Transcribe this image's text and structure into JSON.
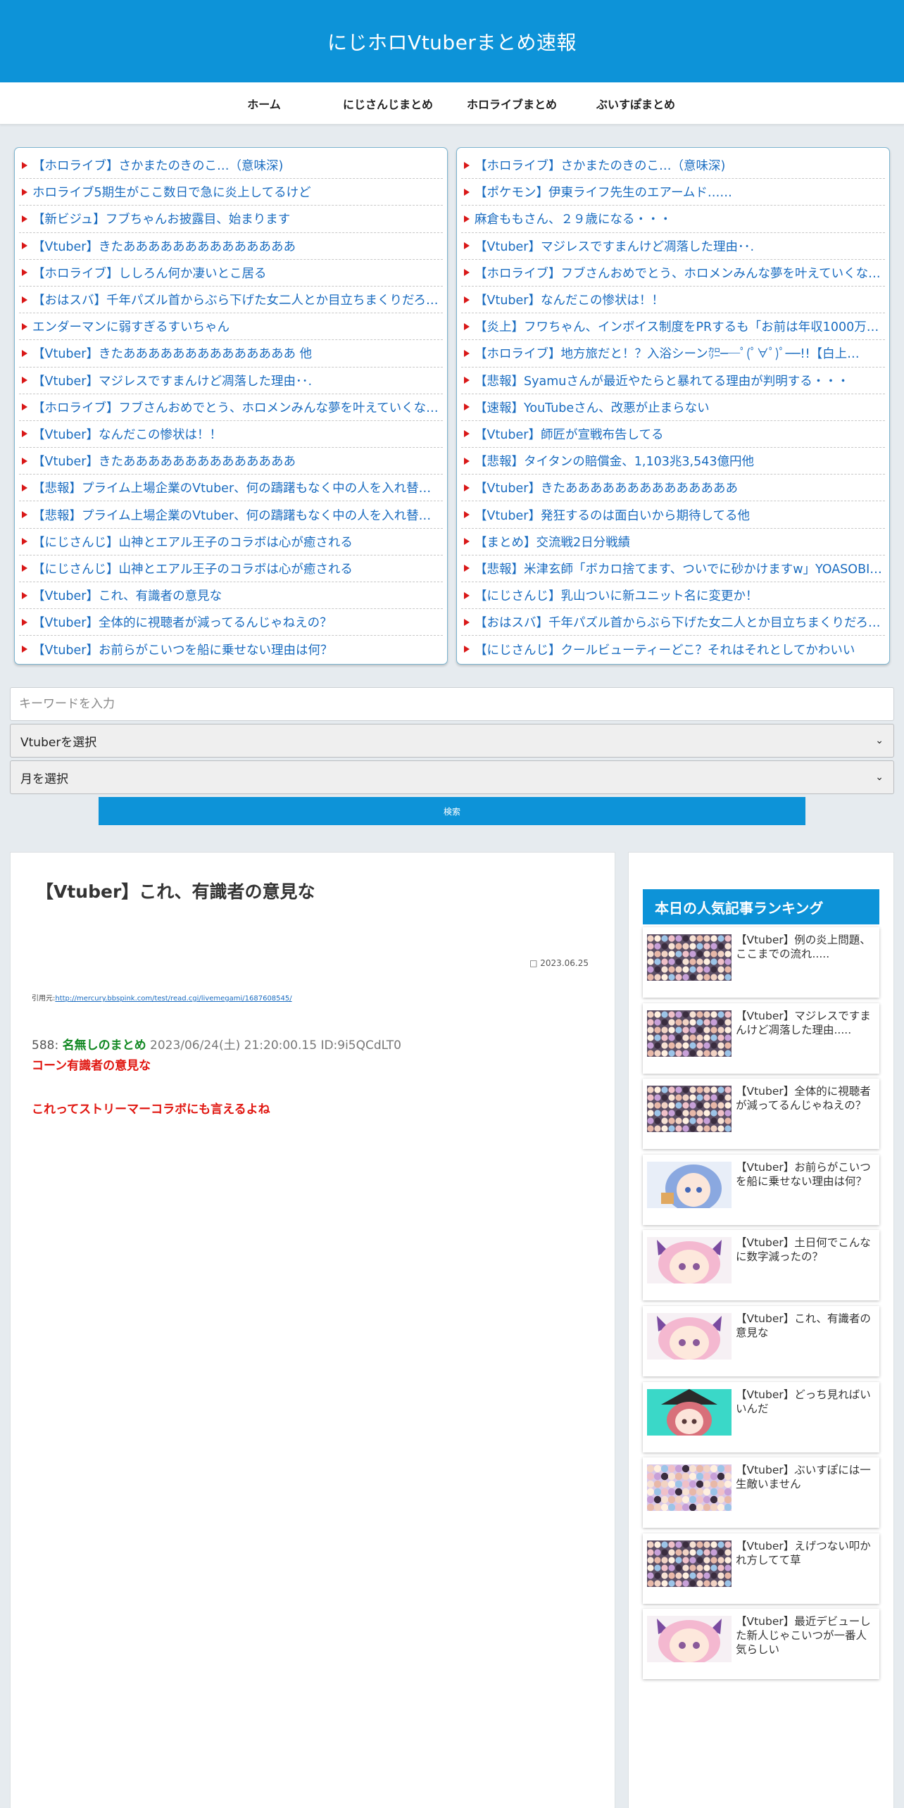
{
  "site": {
    "title": "にじホロVtuberまとめ速報"
  },
  "nav": [
    {
      "label": "ホーム"
    },
    {
      "label": "にじさんじまとめ"
    },
    {
      "label": "ホロライブまとめ"
    },
    {
      "label": "ぶいすぽまとめ"
    }
  ],
  "left_links": [
    "【ホロライブ】さかまたのきのこ…（意味深)",
    "ホロライブ5期生がここ数日で急に炎上してるけど",
    "【新ビジュ】フブちゃんお披露目、始まります",
    "【Vtuber】きたああああああああああああああ",
    "【ホロライブ】ししろん何か凄いとこ居る",
    "【おはスバ】千年パズル首からぶら下げた女二人とか目立ちまくりだろ…",
    "エンダーマンに弱すぎるすいちゃん",
    "【Vtuber】きたああああああああああああああ 他",
    "【Vtuber】マジレスですまんけど凋落した理由･･.",
    "【ホロライブ】フブさんおめでとう、ホロメンみんな夢を叶えていくな…",
    "【Vtuber】なんだこの惨状は！！",
    "【Vtuber】きたああああああああああああああ",
    "【悲報】プライム上場企業のVtuber、何の躊躇もなく中の人を入れ替え…",
    "【悲報】プライム上場企業のVtuber、何の躊躇もなく中の人を入れ替え…",
    "【にじさんじ】山神とエアル王子のコラボは心が癒される",
    "【にじさんじ】山神とエアル王子のコラボは心が癒される",
    "【Vtuber】これ、有識者の意見な",
    "【Vtuber】全体的に視聴者が減ってるんじゃねえの？",
    "【Vtuber】お前らがこいつを船に乗せない理由は何？"
  ],
  "right_links": [
    "【ホロライブ】さかまたのきのこ…（意味深)",
    "【ポケモン】伊東ライフ先生のエアームド……",
    "麻倉ももさん、２９歳になる・・・",
    "【Vtuber】マジレスですまんけど凋落した理由･･.",
    "【ホロライブ】フブさんおめでとう、ホロメンみんな夢を叶えていくな…",
    "【Vtuber】なんだこの惨状は！！",
    "【炎上】フワちゃん、インボイス制度をPRするも「お前は年収1000万…",
    "【ホロライブ】地方旅だと！？入浴シーン㌍──ﾟ(ﾟ∀ﾟ)ﾟ──!!【白上…",
    "【悲報】Syamuさんが最近やたらと暴れてる理由が判明する・・・",
    "【速報】YouTubeさん、改悪が止まらない",
    "【Vtuber】師匠が宣戦布告してる",
    "【悲報】タイタンの賠償金、1,103兆3,543億円他",
    "【Vtuber】きたああああああああああああああ",
    "【Vtuber】発狂するのは面白いから期待してる他",
    "【まとめ】交流戦2日分戦績",
    "【悲報】米津玄師「ボカロ捨てます、ついでに砂かけますw」YOASOBI…",
    "【にじさんじ】乳山ついに新ユニット名に変更か！",
    "【おはスバ】千年パズル首からぶら下げた女二人とか目立ちまくりだろ…",
    "【にじさんじ】クールビューティーどこ？それはそれとしてかわいい"
  ],
  "search": {
    "placeholder": "キーワードを入力",
    "vtuber_select": "Vtuberを選択",
    "month_select": "月を選択",
    "button_label": "検索"
  },
  "article": {
    "title": "【Vtuber】これ、有識者の意見な",
    "date": "2023.06.25",
    "date_icon": "clock-icon",
    "quote_prefix": "引用元:",
    "quote_url": "http://mercury.bbspink.com/test/read.cgi/livemegami/1687608545/",
    "res_number": "588:",
    "res_name": "名無しのまとめ",
    "res_meta": "2023/06/24(土) 21:20:00.15 ID:9i5QCdLT0",
    "line1": "コーン有識者の意見な",
    "line2": "これってストリーマーコラボにも言えるよね"
  },
  "ranking": {
    "title": "本日の人気記事ランキング",
    "items": [
      {
        "title": "【Vtuber】例の炎上問題、ここまでの流れ.....",
        "thumb": "crowd"
      },
      {
        "title": "【Vtuber】マジレスですまんけど凋落した理由.....",
        "thumb": "crowd"
      },
      {
        "title": "【Vtuber】全体的に視聴者が減ってるんじゃねえの？",
        "thumb": "crowd"
      },
      {
        "title": "【Vtuber】お前らがこいつを船に乗せない理由は何？",
        "thumb": "bluehair"
      },
      {
        "title": "【Vtuber】土日何でこんなに数字減ったの？",
        "thumb": "pinkhair"
      },
      {
        "title": "【Vtuber】これ、有識者の意見な",
        "thumb": "pinkhair"
      },
      {
        "title": "【Vtuber】どっち見ればいいんだ",
        "thumb": "witch"
      },
      {
        "title": "【Vtuber】ぶいすぽには一生敵いません",
        "thumb": "group"
      },
      {
        "title": "【Vtuber】えげつない叩かれ方してて草",
        "thumb": "crowd"
      },
      {
        "title": "【Vtuber】最近デビューした新人じゃこいつが一番人気らしい",
        "thumb": "pinkhair"
      }
    ]
  }
}
